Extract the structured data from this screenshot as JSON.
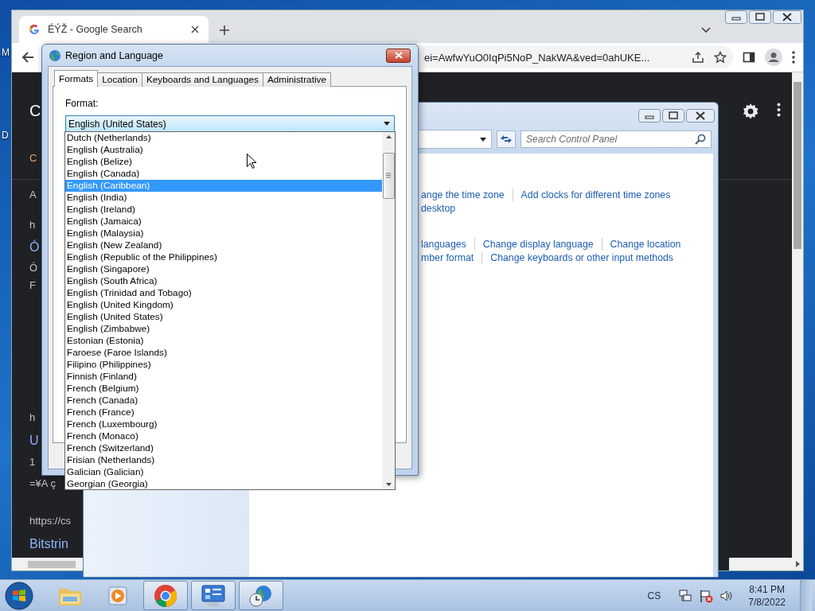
{
  "desktop": {
    "icon_labels": [
      "M",
      "D"
    ]
  },
  "browser": {
    "tab_title": "ÉÝŽ - Google Search",
    "address": "ei=AwfwYuO0IqPi5NoP_NakWA&ved=0ahUKE...",
    "page_fragments": [
      {
        "text": "C",
        "kind": "logo"
      },
      {
        "text": "C",
        "kind": "accent"
      },
      {
        "text": "A",
        "kind": "plain"
      },
      {
        "text": "h",
        "kind": "plain"
      },
      {
        "text": "Ó",
        "kind": "link"
      },
      {
        "text": "Ó",
        "kind": "plain"
      },
      {
        "text": "F",
        "kind": "plain"
      },
      {
        "text": "h",
        "kind": "plain"
      },
      {
        "text": "U",
        "kind": "link"
      },
      {
        "text": "1",
        "kind": "plain"
      },
      {
        "text": "=¥A ç",
        "kind": "plain"
      },
      {
        "text": "https://cs",
        "kind": "plain"
      },
      {
        "text": "Bitstrin",
        "kind": "link"
      }
    ]
  },
  "control_panel": {
    "search": {
      "placeholder": "Search Control Panel"
    },
    "link_rows": [
      [
        "ange the time zone",
        "Add clocks for different time zones"
      ],
      [
        "desktop"
      ],
      [
        "languages",
        "Change display language",
        "Change location"
      ],
      [
        "mber format",
        "Change keyboards or other input methods"
      ]
    ]
  },
  "dialog": {
    "title": "Region and Language",
    "tabs": [
      {
        "label": "Formats",
        "selected": true
      },
      {
        "label": "Location",
        "selected": false
      },
      {
        "label": "Keyboards and Languages",
        "selected": false
      },
      {
        "label": "Administrative",
        "selected": false
      }
    ],
    "format_label": "Format:",
    "format_value": "English (United States)",
    "options": [
      {
        "label": "Dutch (Netherlands)",
        "selected": false
      },
      {
        "label": "English (Australia)",
        "selected": false
      },
      {
        "label": "English (Belize)",
        "selected": false
      },
      {
        "label": "English (Canada)",
        "selected": false
      },
      {
        "label": "English (Caribbean)",
        "selected": true
      },
      {
        "label": "English (India)",
        "selected": false
      },
      {
        "label": "English (Ireland)",
        "selected": false
      },
      {
        "label": "English (Jamaica)",
        "selected": false
      },
      {
        "label": "English (Malaysia)",
        "selected": false
      },
      {
        "label": "English (New Zealand)",
        "selected": false
      },
      {
        "label": "English (Republic of the Philippines)",
        "selected": false
      },
      {
        "label": "English (Singapore)",
        "selected": false
      },
      {
        "label": "English (South Africa)",
        "selected": false
      },
      {
        "label": "English (Trinidad and Tobago)",
        "selected": false
      },
      {
        "label": "English (United Kingdom)",
        "selected": false
      },
      {
        "label": "English (United States)",
        "selected": false
      },
      {
        "label": "English (Zimbabwe)",
        "selected": false
      },
      {
        "label": "Estonian (Estonia)",
        "selected": false
      },
      {
        "label": "Faroese (Faroe Islands)",
        "selected": false
      },
      {
        "label": "Filipino (Philippines)",
        "selected": false
      },
      {
        "label": "Finnish (Finland)",
        "selected": false
      },
      {
        "label": "French (Belgium)",
        "selected": false
      },
      {
        "label": "French (Canada)",
        "selected": false
      },
      {
        "label": "French (France)",
        "selected": false
      },
      {
        "label": "French (Luxembourg)",
        "selected": false
      },
      {
        "label": "French (Monaco)",
        "selected": false
      },
      {
        "label": "French (Switzerland)",
        "selected": false
      },
      {
        "label": "Frisian (Netherlands)",
        "selected": false
      },
      {
        "label": "Galician (Galician)",
        "selected": false
      },
      {
        "label": "Georgian (Georgia)",
        "selected": false
      }
    ]
  },
  "taskbar": {
    "apps": [
      {
        "kind": "explorer",
        "open": false
      },
      {
        "kind": "media",
        "open": false
      },
      {
        "kind": "chrome",
        "open": true
      },
      {
        "kind": "control-panel",
        "open": true
      },
      {
        "kind": "region",
        "open": true
      }
    ],
    "language": "CS",
    "time": "8:41 PM",
    "date": "7/8/2022"
  }
}
